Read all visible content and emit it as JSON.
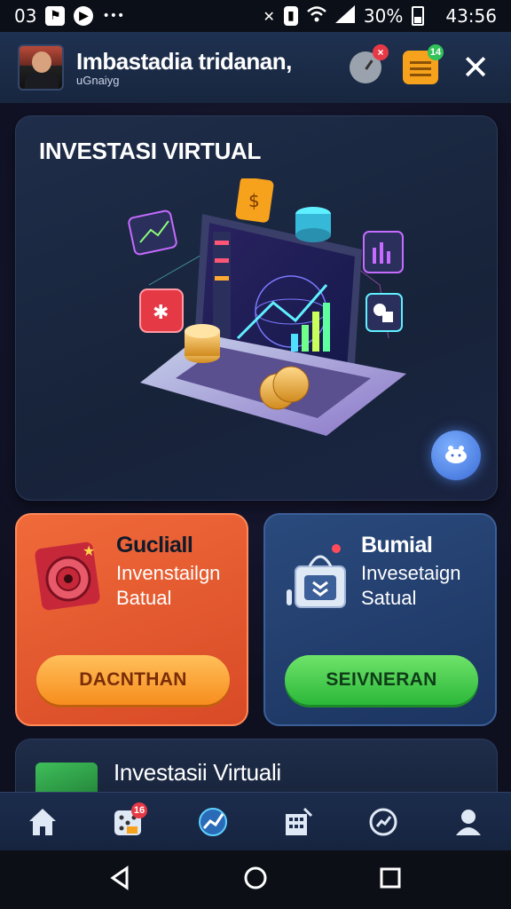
{
  "status_bar": {
    "time_left": "03",
    "battery": "30%",
    "time_right": "43:56"
  },
  "header": {
    "title": "Imbastadia tridanan,",
    "subtitle": "uGnaiyg",
    "notif_badge": "",
    "calendar_badge": "14"
  },
  "hero": {
    "title": "INVESTASI VIRTUAL"
  },
  "cards": [
    {
      "title": "Gucliall",
      "subtitle": "Invenstailgn Batual",
      "button_label": "DACNTHAN"
    },
    {
      "title": "Bumial",
      "subtitle": "Invesetaign Satual",
      "button_label": "SEIVNERAN"
    }
  ],
  "bottom_card": {
    "title": "Investasii Virtuali"
  },
  "tabbar": {
    "items": [
      {
        "icon": "home-icon"
      },
      {
        "icon": "dice-icon",
        "badge": "16"
      },
      {
        "icon": "chart-icon"
      },
      {
        "icon": "building-icon"
      },
      {
        "icon": "analytics-icon"
      },
      {
        "icon": "profile-icon"
      }
    ]
  },
  "colors": {
    "accent_orange": "#f06a3a",
    "accent_blue": "#2a4a7d",
    "button_orange": "#f7a21c",
    "button_green": "#2cb83a",
    "background": "#0d1424"
  }
}
